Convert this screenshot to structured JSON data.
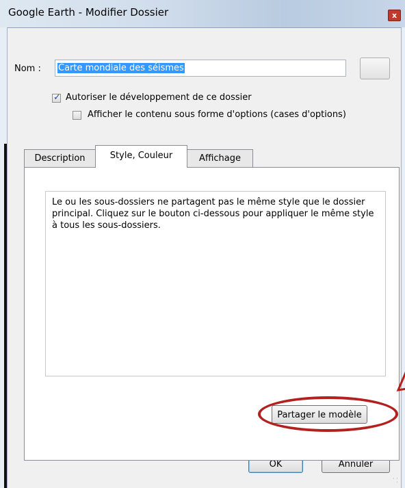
{
  "window": {
    "title": "Google Earth - Modifier Dossier",
    "close_glyph": "x"
  },
  "name_field": {
    "label": "Nom :",
    "value": "Carte mondiale des séismes"
  },
  "options": {
    "expand_folder": {
      "label": "Autoriser le développement de ce dossier",
      "checked": true
    },
    "radio_options": {
      "label": "Afficher le contenu sous forme d'options (cases d'options)",
      "checked": false
    }
  },
  "tabs": [
    {
      "label": "Description",
      "active": false
    },
    {
      "label": "Style, Couleur",
      "active": true
    },
    {
      "label": "Affichage",
      "active": false
    }
  ],
  "style_tab": {
    "message": "Le ou les sous-dossiers ne partagent pas le même style que le dossier principal. Cliquez sur le bouton ci-dessous pour appliquer le même style à tous les sous-dossiers.",
    "share_button": "Partager le modèle"
  },
  "footer": {
    "ok": "OK",
    "cancel": "Annuler"
  },
  "colors": {
    "highlight_ellipse": "#b22020",
    "selection": "#3399ff"
  }
}
